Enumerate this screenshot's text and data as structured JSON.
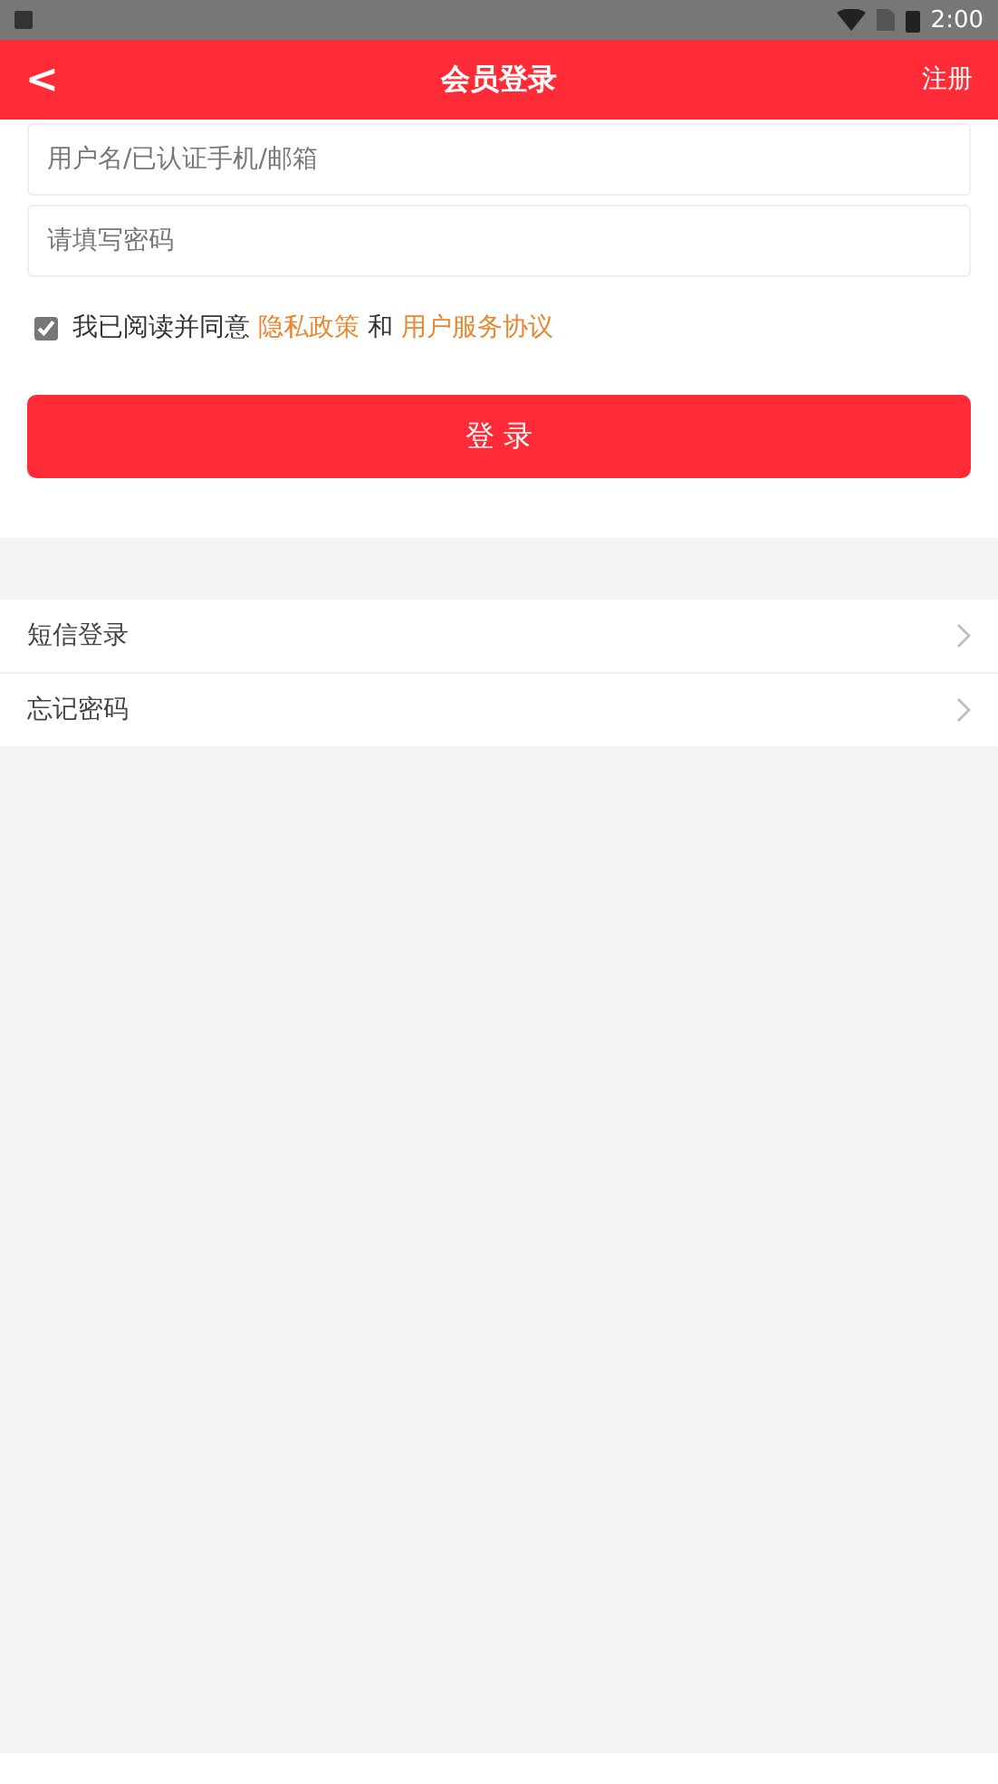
{
  "status_bar": {
    "time": "2:00"
  },
  "header": {
    "back": "<",
    "title": "会员登录",
    "action": "注册"
  },
  "form": {
    "username": {
      "placeholder": "用户名/已认证手机/邮箱"
    },
    "password": {
      "placeholder": "请填写密码"
    },
    "agreement": {
      "checked": true,
      "text": "我已阅读并同意",
      "privacy_link": "隐私政策",
      "joiner": "和",
      "terms_link": "用户服务协议"
    },
    "submit": "登 录"
  },
  "menu": [
    {
      "label": "短信登录"
    },
    {
      "label": "忘记密码"
    }
  ]
}
